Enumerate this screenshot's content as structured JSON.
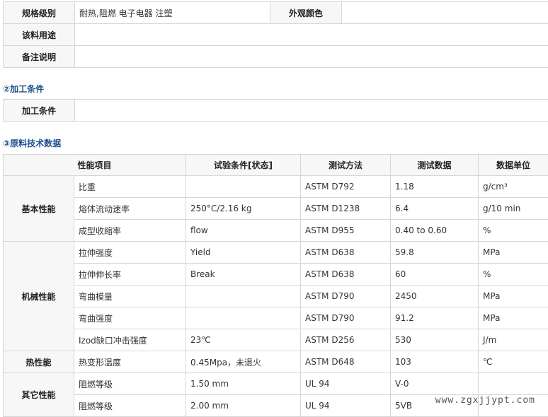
{
  "basic": {
    "grade_label": "规格级别",
    "grade_value": "耐热,阻燃 电子电器 注塑",
    "color_label": "外观颜色",
    "color_value": "",
    "usage_label": "该料用途",
    "usage_value": "",
    "notes_label": "备注说明",
    "notes_value": ""
  },
  "processing": {
    "section_title": "②加工条件",
    "label": "加工条件",
    "value": ""
  },
  "tech": {
    "section_title": "③原料技术数据",
    "headers": [
      "性能项目",
      "试验条件[状态]",
      "测试方法",
      "测试数据",
      "数据单位"
    ],
    "groups": [
      "基本性能",
      "机械性能",
      "热性能",
      "其它性能"
    ],
    "rows": [
      {
        "item": "比重",
        "cond": "",
        "method": "ASTM D792",
        "value": "1.18",
        "unit": "g/cm³"
      },
      {
        "item": "熔体流动速率",
        "cond": "250°C/2.16 kg",
        "method": "ASTM D1238",
        "value": "6.4",
        "unit": "g/10 min"
      },
      {
        "item": "成型收缩率",
        "cond": "flow",
        "method": "ASTM D955",
        "value": "0.40 to 0.60",
        "unit": "%"
      },
      {
        "item": "拉伸强度",
        "cond": "Yield",
        "method": "ASTM D638",
        "value": "59.8",
        "unit": "MPa"
      },
      {
        "item": "拉伸伸长率",
        "cond": "Break",
        "method": "ASTM D638",
        "value": "60",
        "unit": "%"
      },
      {
        "item": "弯曲模量",
        "cond": "",
        "method": "ASTM D790",
        "value": "2450",
        "unit": "MPa"
      },
      {
        "item": "弯曲强度",
        "cond": "",
        "method": "ASTM D790",
        "value": "91.2",
        "unit": "MPa"
      },
      {
        "item": "Izod缺口冲击强度",
        "cond": "23℃",
        "method": "ASTM D256",
        "value": "530",
        "unit": "J/m"
      },
      {
        "item": "热变形温度",
        "cond": "0.45Mpa，未退火",
        "method": "ASTM D648",
        "value": "103",
        "unit": "℃"
      },
      {
        "item": "阻燃等级",
        "cond": "1.50 mm",
        "method": "UL 94",
        "value": "V-0",
        "unit": ""
      },
      {
        "item": "阻燃等级",
        "cond": "2.00 mm",
        "method": "UL 94",
        "value": "5VB",
        "unit": ""
      }
    ]
  },
  "watermark": "www.zgxjjypt.com"
}
